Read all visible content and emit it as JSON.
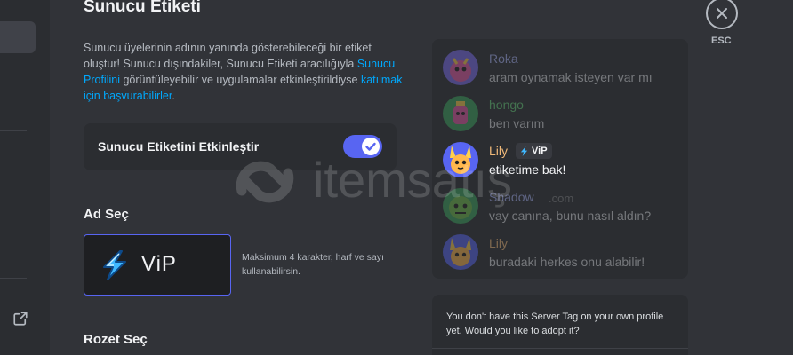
{
  "header": {
    "title": "Sunucu Etiketi"
  },
  "description": {
    "part1": "Sunucu üyelerinin adının yanında gösterebileceği bir etiket oluştur! Sunucu dışındakiler, Sunucu Etiketi aracılığıyla ",
    "link1": "Sunucu Profilini",
    "part2": " görüntüleyebilir ve uygulamalar etkinleştirildiyse ",
    "link2": "katılmak için başvurabilirler",
    "part3": "."
  },
  "toggle": {
    "label": "Sunucu Etiketini Etkinleştir",
    "enabled": true
  },
  "name_section": {
    "heading": "Ad Seç",
    "value": "ViP",
    "hint": "Maksimum 4 karakter, harf ve sayı kullanabilirsin."
  },
  "badge_section": {
    "heading": "Rozet Seç"
  },
  "preview": {
    "messages": [
      {
        "name": "Roka",
        "text": "aram oynamak isteyen var mı",
        "name_color": "#a7b2f7",
        "dim": true
      },
      {
        "name": "hongo",
        "text": "ben varım",
        "name_color": "#66d17a",
        "dim": true
      },
      {
        "name": "Lily",
        "text": "etiketime bak!",
        "name_color": "#f0b979",
        "dim": false,
        "tag": "ViP"
      },
      {
        "name": "Shadow",
        "text": "vay canına, bunu nasıl aldın?",
        "name_color": "#a7b2f7",
        "dim": true
      },
      {
        "name": "Lily",
        "text": "buradaki herkes onu alabilir!",
        "name_color": "#f0b979",
        "dim": true
      }
    ]
  },
  "adopt": {
    "text": "You don't have this Server Tag on your own profile yet. Would you like to adopt it?"
  },
  "close": {
    "label": "ESC"
  },
  "watermark": {
    "brand": "itemsatış",
    "suffix": ".com"
  },
  "colors": {
    "accent": "#5865f2",
    "link": "#00a8fc",
    "bg": "#313338",
    "panel": "#2b2d31"
  },
  "icons": {
    "close": "close-icon",
    "external": "external-link-icon",
    "bolt": "lightning-bolt-icon",
    "check": "check-icon"
  }
}
